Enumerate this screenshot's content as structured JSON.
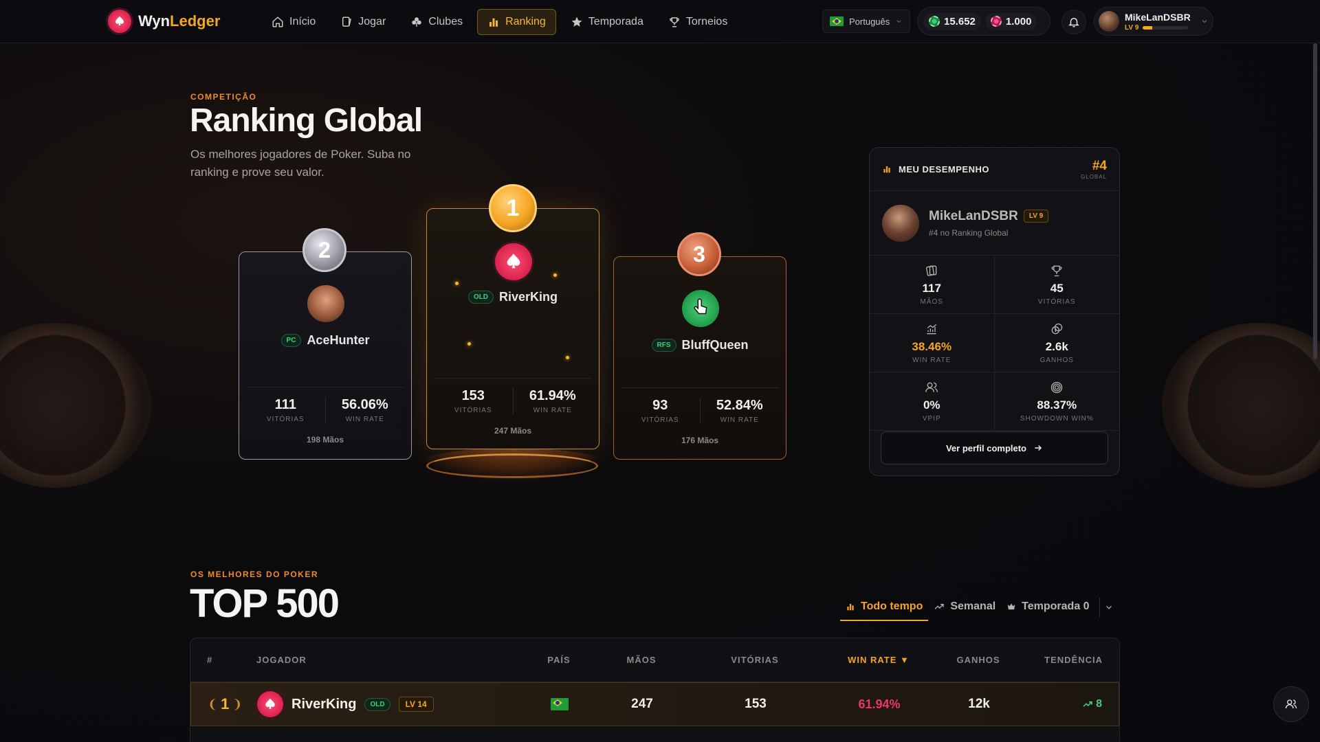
{
  "brand": {
    "name_part1": "Wyn",
    "name_part2": "Ledger"
  },
  "nav": {
    "items": [
      {
        "label": "Início",
        "icon": "home-icon"
      },
      {
        "label": "Jogar",
        "icon": "cards-icon"
      },
      {
        "label": "Clubes",
        "icon": "club-icon"
      },
      {
        "label": "Ranking",
        "icon": "bar-chart-icon",
        "active": true
      },
      {
        "label": "Temporada",
        "icon": "star-icon"
      },
      {
        "label": "Torneios",
        "icon": "trophy-icon"
      }
    ],
    "language": "Português",
    "balance_green": "15.652",
    "balance_pink": "1.000",
    "user_name": "MikeLanDSBR",
    "user_level": "LV 9",
    "user_level_progress": 0.2
  },
  "hero": {
    "eyebrow": "COMPETIÇÃO",
    "title": "Ranking Global",
    "subtitle": "Os melhores jogadores de Poker. Suba no ranking e prove seu valor."
  },
  "podium": [
    {
      "place": "2",
      "tag": "PC",
      "name": "AceHunter",
      "wins": "111",
      "wins_label": "VITÓRIAS",
      "win_rate": "56.06%",
      "win_rate_label": "WIN RATE",
      "hands": "198 Mãos"
    },
    {
      "place": "1",
      "tag": "OLD",
      "name": "RiverKing",
      "wins": "153",
      "wins_label": "VITÓRIAS",
      "win_rate": "61.94%",
      "win_rate_label": "WIN RATE",
      "hands": "247 Mãos"
    },
    {
      "place": "3",
      "tag": "RFS",
      "name": "BluffQueen",
      "wins": "93",
      "wins_label": "VITÓRIAS",
      "win_rate": "52.84%",
      "win_rate_label": "WIN RATE",
      "hands": "176 Mãos"
    }
  ],
  "performance": {
    "title": "MEU DESEMPENHO",
    "rank": "#4",
    "rank_label": "GLOBAL",
    "name": "MikeLanDSBR",
    "level": "LV 9",
    "subtitle": "#4 no Ranking Global",
    "stats": [
      {
        "value": "117",
        "label": "MÃOS",
        "icon": "cards-icon"
      },
      {
        "value": "45",
        "label": "VITÓRIAS",
        "icon": "trophy-icon"
      },
      {
        "value": "38.46%",
        "label": "WIN RATE",
        "icon": "trend-chart-icon",
        "accent": true
      },
      {
        "value": "2.6k",
        "label": "GANHOS",
        "icon": "coins-icon"
      },
      {
        "value": "0%",
        "label": "VPIP",
        "icon": "users-icon"
      },
      {
        "value": "88.37%",
        "label": "SHOWDOWN WIN%",
        "icon": "target-icon"
      }
    ],
    "button": "Ver perfil completo"
  },
  "top500": {
    "eyebrow": "OS MELHORES DO POKER",
    "title": "TOP 500",
    "filters": [
      {
        "label": "Todo tempo",
        "active": true
      },
      {
        "label": "Semanal"
      },
      {
        "label": "Temporada 0"
      }
    ],
    "columns": [
      "#",
      "JOGADOR",
      "PAÍS",
      "MÃOS",
      "VITÓRIAS",
      "WIN RATE",
      "GANHOS",
      "TENDÊNCIA"
    ],
    "rows": [
      {
        "rank": "1",
        "name": "RiverKing",
        "tag": "OLD",
        "level": "LV 14",
        "hands": "247",
        "wins": "153",
        "win_rate": "61.94%",
        "gains": "12k",
        "trend": "8"
      }
    ]
  }
}
